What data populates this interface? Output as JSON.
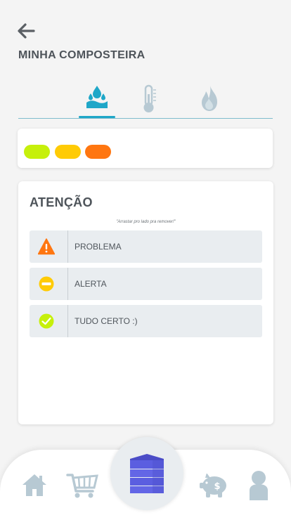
{
  "header": {
    "back_icon": "arrow-left-icon",
    "title": "MINHA COMPOSTEIRA"
  },
  "tabs": [
    {
      "icon": "water-drops-icon",
      "active": true
    },
    {
      "icon": "thermometer-icon",
      "active": false
    },
    {
      "icon": "flame-icon",
      "active": false
    }
  ],
  "status_pills": [
    {
      "color": "#c6f00b"
    },
    {
      "color": "#ffcb05"
    },
    {
      "color": "#ff7610"
    }
  ],
  "alert": {
    "title": "ATENÇÃO",
    "hint": "\"Arrastar pro lado pra remover!\"",
    "items": [
      {
        "icon": "warning-triangle-icon",
        "color": "#ff7610",
        "label": "PROBLEMA"
      },
      {
        "icon": "minus-circle-icon",
        "color": "#ffcb05",
        "label": "ALERTA"
      },
      {
        "icon": "check-circle-icon",
        "color": "#c6f00b",
        "label": "TUDO CERTO :)"
      }
    ]
  },
  "bottom_nav": {
    "items": [
      "home-icon",
      "cart-icon",
      "composter-icon",
      "piggy-bank-icon",
      "profile-icon"
    ],
    "icon_color": "#b7c9d3",
    "center_color": "#5b5ee0"
  }
}
